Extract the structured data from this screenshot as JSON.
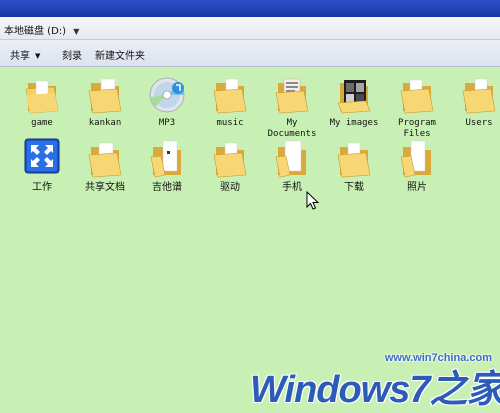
{
  "window": {
    "address": "本地磁盘 (D:)"
  },
  "toolbar": {
    "share_label": "共享",
    "burn_label": "刻录",
    "new_folder_label": "新建文件夹"
  },
  "items": [
    {
      "label": "game",
      "icon": "folder-icon"
    },
    {
      "label": "kankan",
      "icon": "folder-icon"
    },
    {
      "label": "MP3",
      "icon": "cd-folder-icon"
    },
    {
      "label": "music",
      "icon": "folder-icon"
    },
    {
      "label": "My\nDocuments",
      "icon": "folder-icon"
    },
    {
      "label": "My images",
      "icon": "photo-folder-icon"
    },
    {
      "label": "Program\nFiles",
      "icon": "folder-icon"
    },
    {
      "label": "Users",
      "icon": "folder-icon"
    },
    {
      "label": "工作",
      "icon": "app-shortcut-icon"
    },
    {
      "label": "共享文档",
      "icon": "folder-icon"
    },
    {
      "label": "吉他谱",
      "icon": "folder-icon"
    },
    {
      "label": "驱动",
      "icon": "folder-icon"
    },
    {
      "label": "手机",
      "icon": "folder-icon"
    },
    {
      "label": "下载",
      "icon": "folder-icon"
    },
    {
      "label": "照片",
      "icon": "folder-icon"
    }
  ],
  "watermark": {
    "url": "www.win7china.com",
    "brand": "Windows7之家"
  },
  "colors": {
    "content_bg": "#c9f0b4",
    "folder": "#f2c85a",
    "title_bar": "#1f40b8",
    "brand_blue": "#2d5cb8"
  }
}
